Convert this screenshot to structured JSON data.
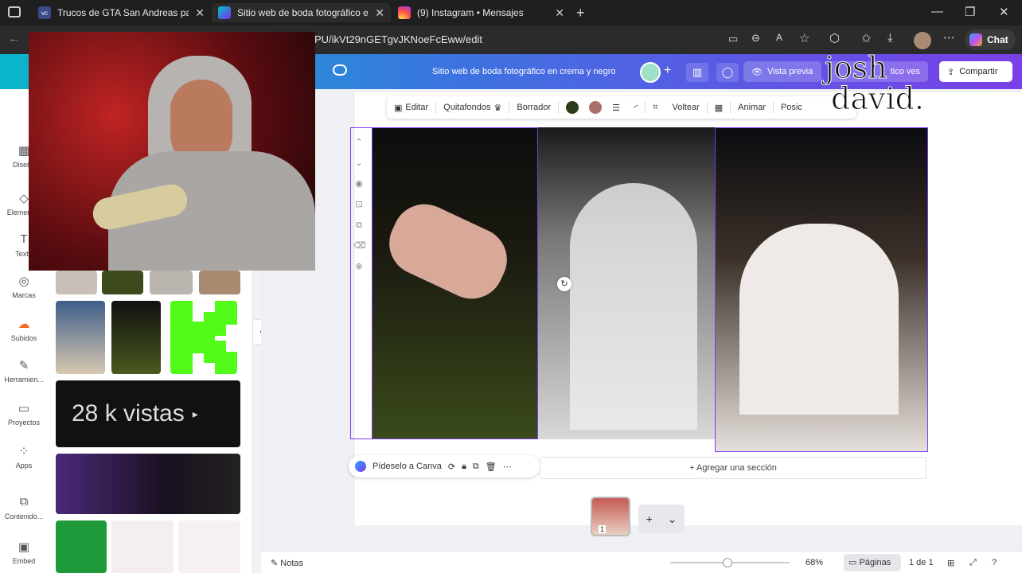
{
  "browser": {
    "tabs": [
      {
        "title": "Trucos de GTA San Andreas para PC",
        "icon": "vidcon-favicon"
      },
      {
        "title": "Sitio web de boda fotográfico en crema y negro",
        "icon": "canva-favicon"
      },
      {
        "title": "(9) Instagram • Mensajes",
        "icon": "instagram-favicon"
      }
    ],
    "url": "PU/ikVt29nGETgvJKNoeFcEww/edit",
    "chat_label": "Chat"
  },
  "canva": {
    "doc_title": "Sitio web de boda fotográfico en crema y negro",
    "preview_label": "Vista previa",
    "share_label": "Compartir",
    "publish_partial": "tico ves",
    "context_toolbar": {
      "edit": "Editar",
      "bg_remove": "Quitafondos",
      "eraser": "Borrador",
      "flip": "Voltear",
      "animate": "Animar",
      "more": "Posic"
    },
    "rail": [
      "Diseño",
      "Elementos",
      "Texto",
      "Marcas",
      "Subidos",
      "Herramien...",
      "Proyectos",
      "Apps",
      "Contenido...",
      "Embed"
    ],
    "upload_card_text": "28 k vistas",
    "ask_canva": "Pídeselo a Canva",
    "add_section": "Agregar una sección",
    "notes": "Notas",
    "zoom": "68%",
    "pages_label": "Páginas",
    "page_count": "1 de 1",
    "page_thumb_number": "1"
  },
  "watermark": {
    "line1": "josh",
    "line2": "david."
  },
  "colors": {
    "swatch1": "#2f3a1a",
    "swatch2": "#a8706b",
    "accent": "#7c3aed"
  }
}
